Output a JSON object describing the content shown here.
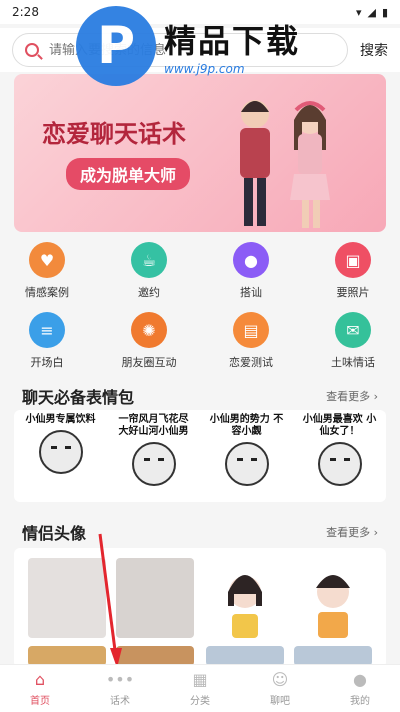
{
  "status_bar": {
    "time": "2:28"
  },
  "search": {
    "placeholder": "请输入要搜索的信息",
    "button": "搜索"
  },
  "watermark": {
    "title": "精品下载",
    "url": "www.j9p.com"
  },
  "banner": {
    "title": "恋爱聊天话术",
    "subtitle": "成为脱单大师"
  },
  "grid": {
    "rows": [
      [
        {
          "label": "情感案例",
          "icon": "heart-icon",
          "color": "#f28a3c"
        },
        {
          "label": "邀约",
          "icon": "cup-icon",
          "color": "#35c1a3"
        },
        {
          "label": "搭讪",
          "icon": "chat-icon",
          "color": "#8b5cf6"
        },
        {
          "label": "要照片",
          "icon": "photo-icon",
          "color": "#ef4f64"
        }
      ],
      [
        {
          "label": "开场白",
          "icon": "list-icon",
          "color": "#3b9fe8"
        },
        {
          "label": "朋友圈互动",
          "icon": "aperture-icon",
          "color": "#f07a2f"
        },
        {
          "label": "恋爱测试",
          "icon": "test-icon",
          "color": "#f58a3a"
        },
        {
          "label": "土味情话",
          "icon": "heart-mail-icon",
          "color": "#35c19a"
        }
      ]
    ]
  },
  "stickers": {
    "title": "聊天必备表情包",
    "more": "查看更多 ›",
    "items": [
      "小仙男专属饮料",
      "一帘风月飞花尽 大好山河小仙男",
      "小仙男的势力 不容小觑",
      "小仙男最喜欢 小仙女了！"
    ]
  },
  "avatars": {
    "title": "情侣头像",
    "more": "查看更多 ›"
  },
  "bottom_nav": {
    "items": [
      {
        "label": "首页",
        "icon": "home-icon",
        "active": true
      },
      {
        "label": "话术",
        "icon": "chat-bubble-icon",
        "active": false
      },
      {
        "label": "分类",
        "icon": "grid-icon",
        "active": false
      },
      {
        "label": "聊吧",
        "icon": "smile-icon",
        "active": false
      },
      {
        "label": "我的",
        "icon": "user-icon",
        "active": false
      }
    ]
  }
}
